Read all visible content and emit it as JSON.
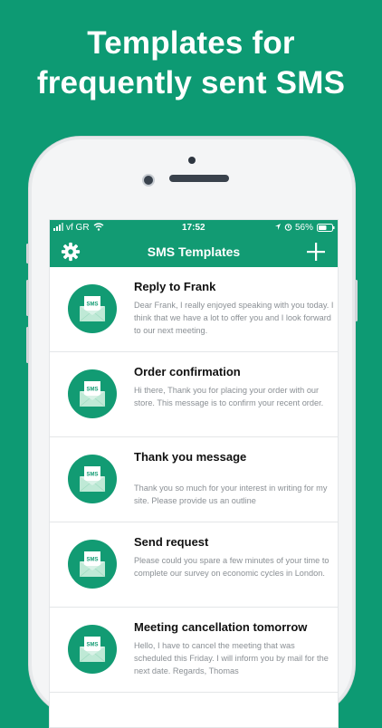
{
  "headline": {
    "line1": "Templates for",
    "line2": "frequently sent SMS"
  },
  "status_bar": {
    "carrier": "vf GR",
    "time": "17:52",
    "battery": "56%"
  },
  "nav": {
    "title": "SMS Templates",
    "settings_icon": "gear-icon",
    "add_icon": "plus-icon"
  },
  "colors": {
    "brand": "#129b73",
    "background": "#0d9a73"
  },
  "templates": [
    {
      "title": "Reply to Frank",
      "body": "Dear Frank, I really enjoyed speaking with you today. I think that we have a lot to offer you and I look forward to our next meeting."
    },
    {
      "title": "Order confirmation",
      "body": "Hi there, Thank you for placing your order with our store. This message is to confirm your recent order."
    },
    {
      "title": "Thank you message",
      "body": "Thank you so much for your interest in writing for my site. Please provide us an outline"
    },
    {
      "title": "Send request",
      "body": "Please could you spare a few minutes of your time to complete our survey on economic cycles in London."
    },
    {
      "title": "Meeting cancellation tomorrow",
      "body": "Hello, I have to cancel the meeting that was scheduled this Friday. I will inform you by mail for the next date. Regards, Thomas"
    }
  ],
  "badge_text": "SMS"
}
